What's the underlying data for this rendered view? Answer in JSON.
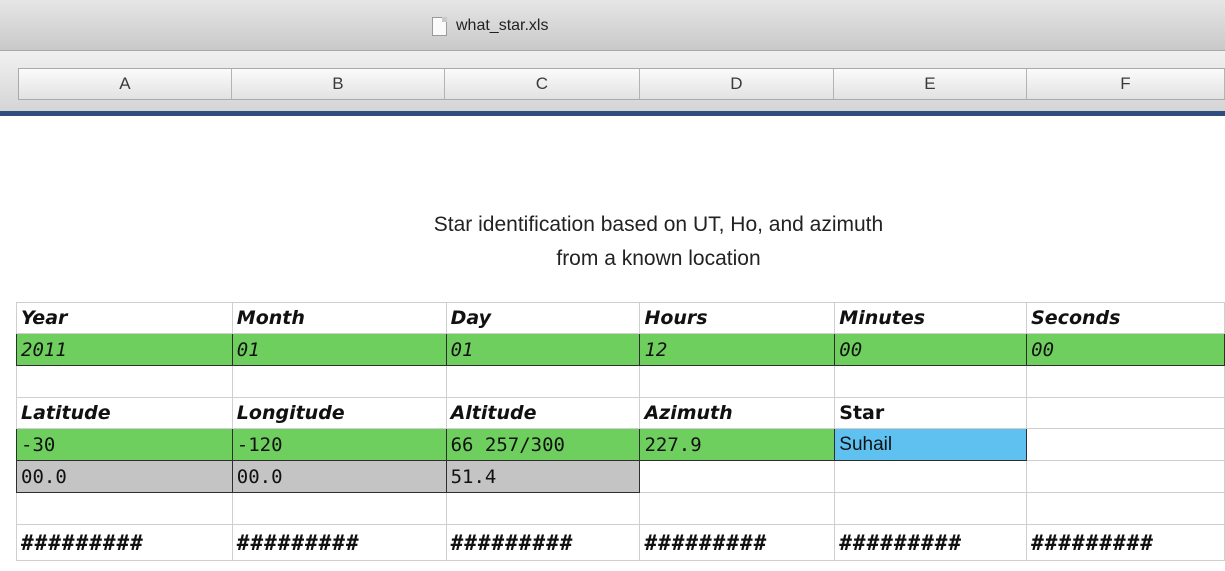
{
  "window": {
    "title": "what_star.xls",
    "file_icon": "document-icon"
  },
  "columns": [
    "A",
    "B",
    "C",
    "D",
    "E",
    "F"
  ],
  "heading": {
    "line1": "Star identification based on UT, Ho, and azimuth",
    "line2": "from a known location"
  },
  "rows": {
    "time_labels": [
      "Year",
      "Month",
      "Day",
      "Hours",
      "Minutes",
      "Seconds"
    ],
    "time_values": [
      "2011",
      "01",
      "01",
      "12",
      "00",
      "00"
    ],
    "location_labels": [
      "Latitude",
      "Longitude",
      "Altitude",
      "Azimuth",
      "Star",
      ""
    ],
    "location_values": [
      "-30",
      "-120",
      "66 257/300",
      "227.9",
      "Suhail",
      ""
    ],
    "extra_values": [
      "00.0",
      "00.0",
      "51.4",
      "",
      "",
      ""
    ],
    "hash_values": [
      "#########",
      "#########",
      "#########",
      "#########",
      "#########",
      "#########"
    ]
  },
  "colors": {
    "input_green": "#6fcf5e",
    "result_blue": "#5ec1ef",
    "computed_gray": "#c4c4c4",
    "header_strip": "#2f4d7e"
  }
}
